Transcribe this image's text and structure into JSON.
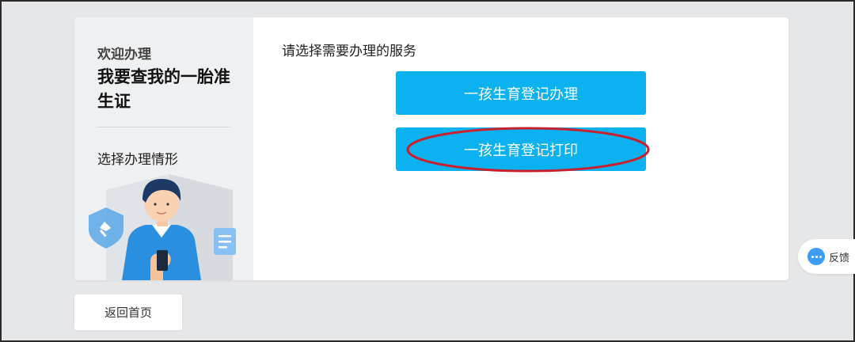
{
  "sidebar": {
    "welcome": "欢迎办理",
    "title": "我要查我的一胎准生证",
    "step": "选择办理情形"
  },
  "main": {
    "prompt": "请选择需要办理的服务",
    "services": [
      {
        "label": "一孩生育登记办理"
      },
      {
        "label": "一孩生育登记打印"
      }
    ]
  },
  "feedback": {
    "label": "反馈",
    "icon": "chat-bubble-icon"
  },
  "back_button": {
    "label": "返回首页"
  },
  "colors": {
    "accent": "#0bb2ef",
    "highlight_ring": "#c8202e",
    "background": "#e6e7e9"
  }
}
